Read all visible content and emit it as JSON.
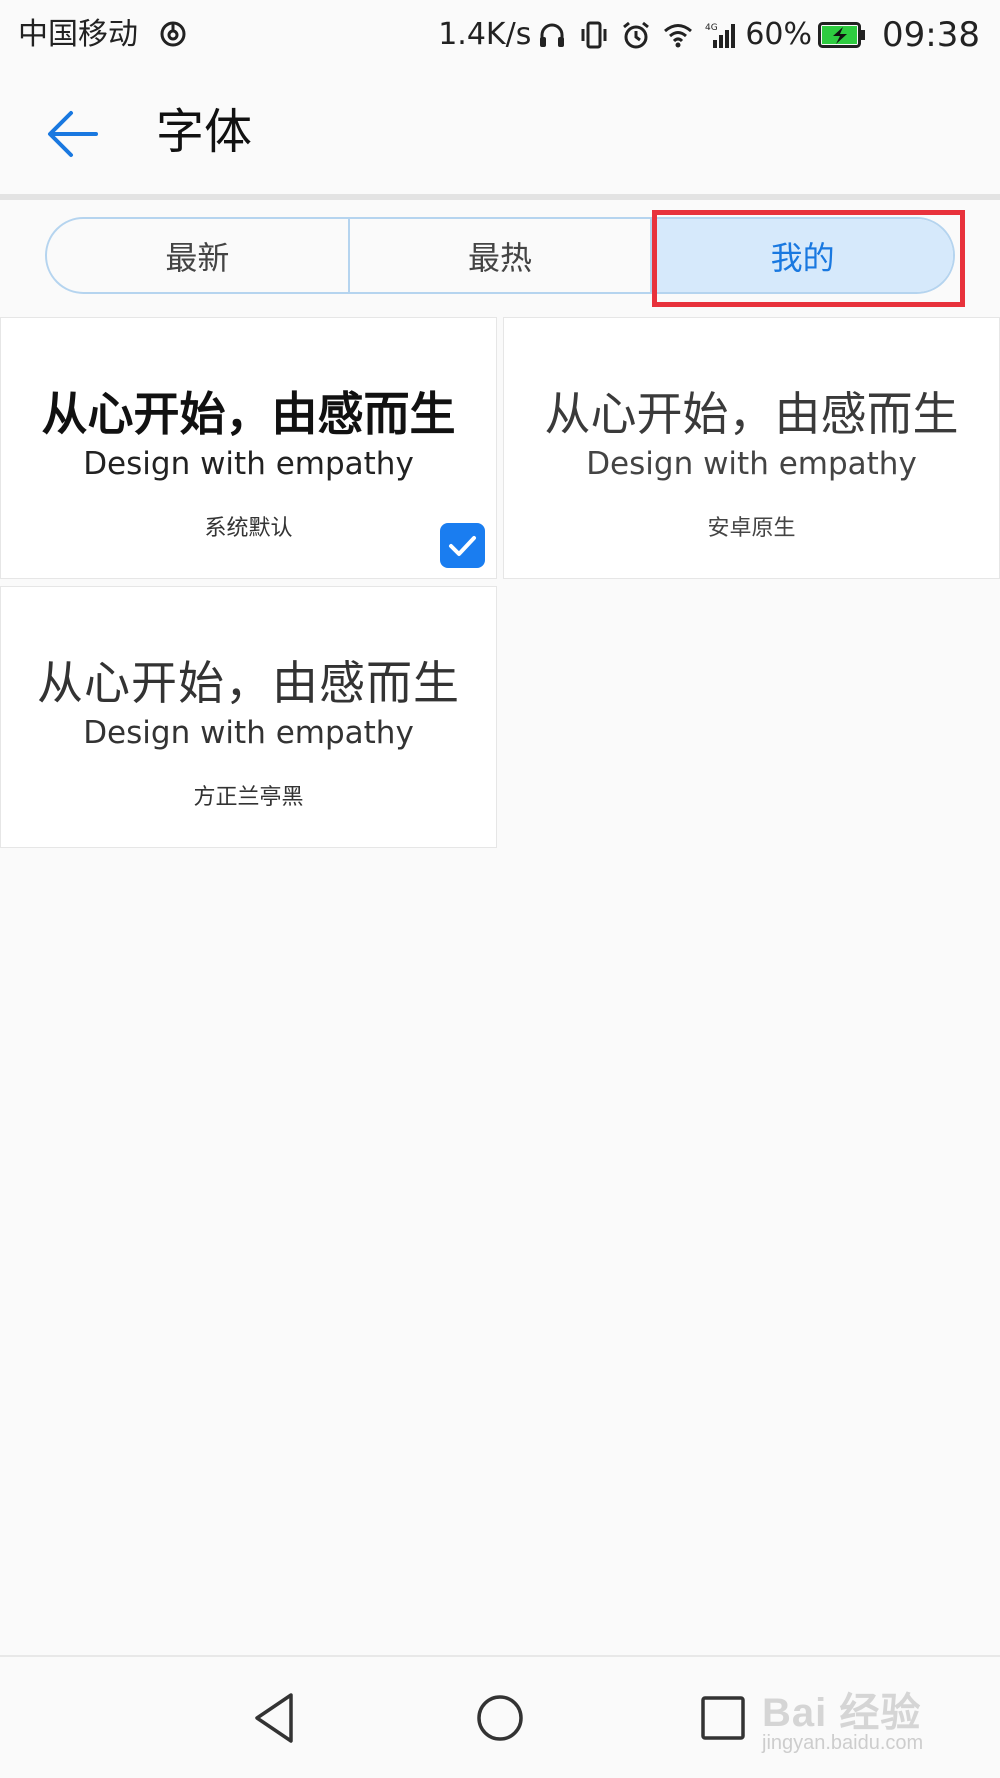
{
  "status_bar": {
    "carrier": "中国移动",
    "net_speed": "1.4K/s",
    "network_type": "4G",
    "battery_percent": "60%",
    "battery_level": 0.6,
    "time": "09:38",
    "icons": [
      "sync-icon",
      "headphones-icon",
      "vibrate-icon",
      "alarm-icon",
      "wifi-icon",
      "signal-icon",
      "battery-charging-icon"
    ]
  },
  "app_bar": {
    "title": "字体",
    "back_icon": "arrow-left-icon"
  },
  "tabs": [
    {
      "label": "最新",
      "selected": false
    },
    {
      "label": "最热",
      "selected": false
    },
    {
      "label": "我的",
      "selected": true
    }
  ],
  "fonts": [
    {
      "sample_cn": "从心开始，由感而生",
      "sample_en": "Design with empathy",
      "name": "系统默认",
      "selected": true
    },
    {
      "sample_cn": "从心开始，由感而生",
      "sample_en": "Design with empathy",
      "name": "安卓原生",
      "selected": false
    },
    {
      "sample_cn": "从心开始，由感而生",
      "sample_en": "Design with empathy",
      "name": "方正兰亭黑",
      "selected": false
    }
  ],
  "nav_bar": {
    "icons": [
      "nav-back-triangle-icon",
      "nav-home-circle-icon",
      "nav-recent-square-icon"
    ]
  },
  "watermark": {
    "title": "Bai 经验",
    "url": "jingyan.baidu.com"
  },
  "colors": {
    "accent": "#1978e0",
    "tab_active_bg": "#d6e9fb",
    "tab_border": "#b5d4ef",
    "highlight": "#e8323c",
    "check_badge": "#1a7df0",
    "background": "#fafafa"
  }
}
